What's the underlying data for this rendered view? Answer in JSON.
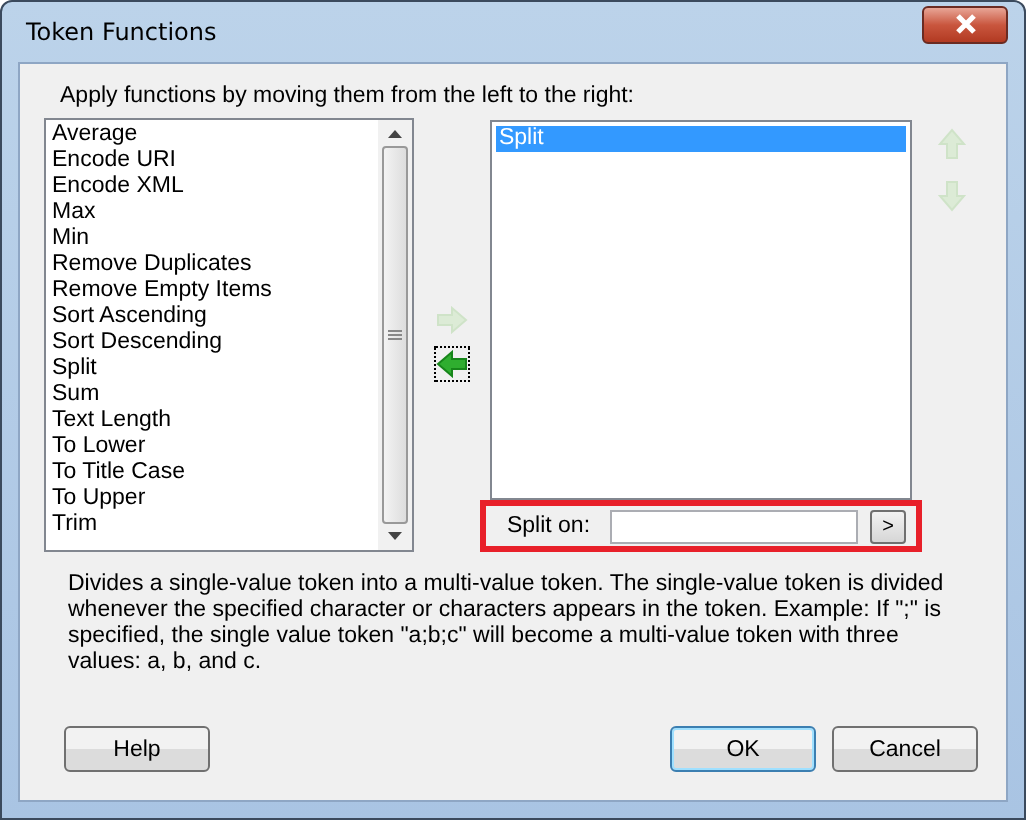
{
  "window": {
    "title": "Token Functions"
  },
  "instruction": "Apply functions by moving them from the left to the right:",
  "available_functions": [
    {
      "label": "Average",
      "selected": false
    },
    {
      "label": "Encode URI",
      "selected": false
    },
    {
      "label": "Encode XML",
      "selected": false
    },
    {
      "label": "Max",
      "selected": false
    },
    {
      "label": "Min",
      "selected": false
    },
    {
      "label": "Remove Duplicates",
      "selected": false
    },
    {
      "label": "Remove Empty Items",
      "selected": false
    },
    {
      "label": "Sort Ascending",
      "selected": false
    },
    {
      "label": "Sort Descending",
      "selected": false
    },
    {
      "label": "Split",
      "selected": false
    },
    {
      "label": "Sum",
      "selected": false
    },
    {
      "label": "Text Length",
      "selected": false
    },
    {
      "label": "To Lower",
      "selected": false
    },
    {
      "label": "To Title Case",
      "selected": false
    },
    {
      "label": "To Upper",
      "selected": false
    },
    {
      "label": "Trim",
      "selected": false
    }
  ],
  "move_buttons": {
    "add_disabled": true,
    "remove_disabled": false,
    "up_disabled": true,
    "down_disabled": true
  },
  "applied_functions": [
    {
      "label": "Split",
      "selected": true
    }
  ],
  "split_options": {
    "label": "Split on:",
    "highlighted": true,
    "button": ">"
  },
  "description": "Divides a single-value token into a multi-value token. The single-value token is divided whenever the specified character or characters appears in the token. Example: If \";\" is specified, the single value token \"a;b;c\" will become a multi-value token with three values: a, b, and c.",
  "buttons": [
    {
      "label": "Help",
      "kind": "help"
    },
    {
      "label": "OK",
      "kind": "default"
    },
    {
      "label": "Cancel",
      "kind": "cancel"
    }
  ]
}
